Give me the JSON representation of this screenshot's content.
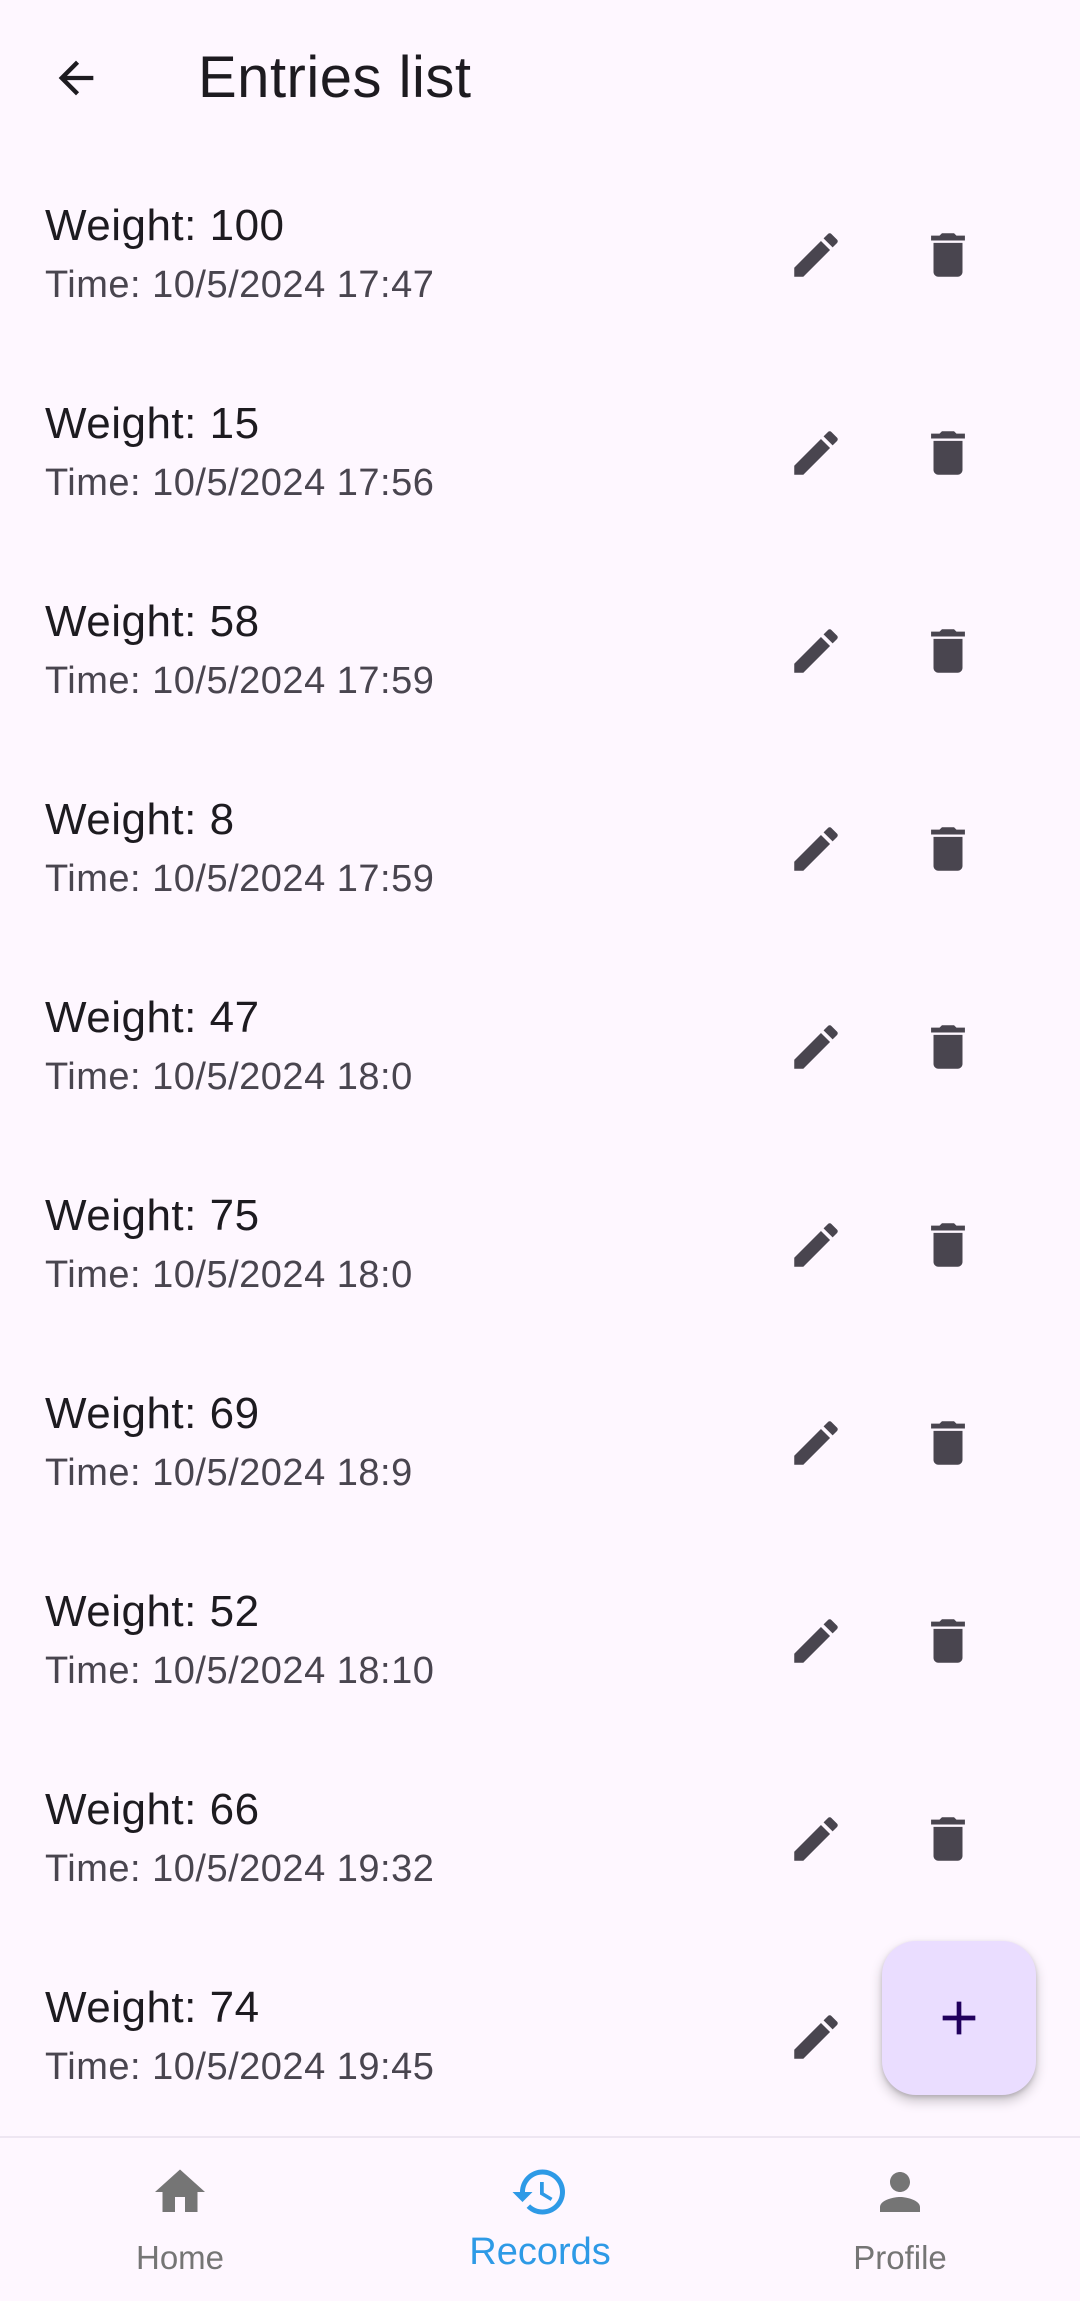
{
  "header": {
    "title": "Entries list",
    "back_icon": "arrow-back-icon"
  },
  "entries": [
    {
      "weight": "Weight: 100",
      "time": "Time: 10/5/2024 17:47"
    },
    {
      "weight": "Weight: 15",
      "time": "Time: 10/5/2024 17:56"
    },
    {
      "weight": "Weight: 58",
      "time": "Time: 10/5/2024 17:59"
    },
    {
      "weight": "Weight: 8",
      "time": "Time: 10/5/2024 17:59"
    },
    {
      "weight": "Weight: 47",
      "time": "Time: 10/5/2024 18:0"
    },
    {
      "weight": "Weight: 75",
      "time": "Time: 10/5/2024 18:0"
    },
    {
      "weight": "Weight: 69",
      "time": "Time: 10/5/2024 18:9"
    },
    {
      "weight": "Weight: 52",
      "time": "Time: 10/5/2024 18:10"
    },
    {
      "weight": "Weight: 66",
      "time": "Time: 10/5/2024 19:32"
    },
    {
      "weight": "Weight: 74",
      "time": "Time: 10/5/2024 19:45"
    }
  ],
  "entry_actions": {
    "edit_icon": "pencil-icon",
    "delete_icon": "trash-icon"
  },
  "fab": {
    "icon": "plus-icon"
  },
  "bottom_nav": {
    "items": [
      {
        "label": "Home",
        "icon": "home-icon",
        "active": false
      },
      {
        "label": "Records",
        "icon": "history-icon",
        "active": true
      },
      {
        "label": "Profile",
        "icon": "person-icon",
        "active": false
      }
    ]
  },
  "colors": {
    "background": "#FEF7FF",
    "icon": "#49454F",
    "fab_background": "#EADDFF",
    "active_nav": "#2E9AE6",
    "inactive_nav": "#757575"
  }
}
